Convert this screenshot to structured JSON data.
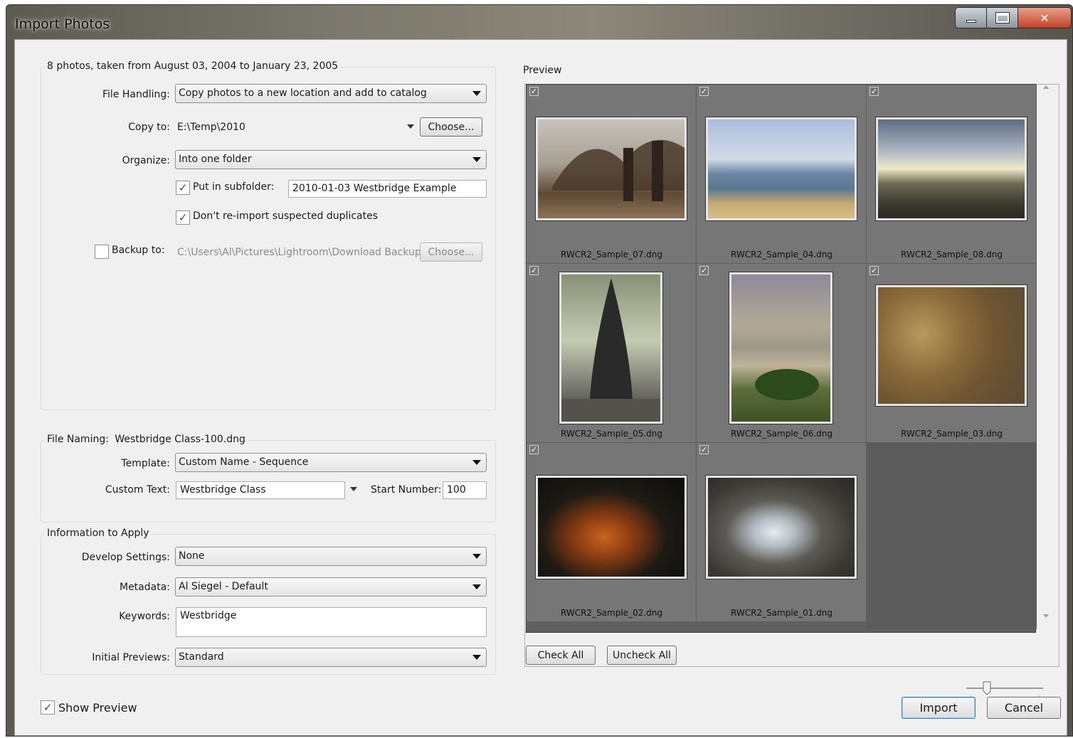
{
  "window": {
    "title": "Import Photos"
  },
  "source_group": {
    "legend": "8 photos, taken from August 03, 2004 to January 23, 2005"
  },
  "file_handling": {
    "label": "File Handling:",
    "value": "Copy photos to a new location and add to catalog"
  },
  "copy_to": {
    "label": "Copy to:",
    "value": "E:\\Temp\\2010",
    "button": "Choose..."
  },
  "organize": {
    "label": "Organize:",
    "value": "Into one folder"
  },
  "subfolder": {
    "checked": true,
    "label": "Put in subfolder:",
    "value": "2010-01-03 Westbridge Example"
  },
  "duplicates": {
    "checked": true,
    "label": "Don't re-import suspected duplicates"
  },
  "backup": {
    "checked": false,
    "label": "Backup to:",
    "value": "C:\\Users\\Al\\Pictures\\Lightroom\\Download Backups",
    "button": "Choose..."
  },
  "naming": {
    "legend_label": "File Naming:",
    "legend_value": "Westbridge Class-100.dng",
    "template_label": "Template:",
    "template_value": "Custom Name - Sequence",
    "custom_text_label": "Custom Text:",
    "custom_text_value": "Westbridge Class",
    "start_number_label": "Start Number:",
    "start_number_value": "100"
  },
  "info": {
    "legend": "Information to Apply",
    "develop_label": "Develop Settings:",
    "develop_value": "None",
    "metadata_label": "Metadata:",
    "metadata_value": "Al Siegel - Default",
    "keywords_label": "Keywords:",
    "keywords_value": "Westbridge",
    "previews_label": "Initial Previews:",
    "previews_value": "Standard"
  },
  "preview": {
    "legend": "Preview",
    "thumbnails": [
      {
        "filename": "RWCR2_Sample_07.dng",
        "checked": true,
        "subject": "bridge"
      },
      {
        "filename": "RWCR2_Sample_04.dng",
        "checked": true,
        "subject": "beach"
      },
      {
        "filename": "RWCR2_Sample_08.dng",
        "checked": true,
        "subject": "harbor"
      },
      {
        "filename": "RWCR2_Sample_05.dng",
        "checked": true,
        "subject": "ship"
      },
      {
        "filename": "RWCR2_Sample_06.dng",
        "checked": true,
        "subject": "coast-tree"
      },
      {
        "filename": "RWCR2_Sample_03.dng",
        "checked": true,
        "subject": "sand"
      },
      {
        "filename": "RWCR2_Sample_02.dng",
        "checked": true,
        "subject": "koi-fish"
      },
      {
        "filename": "RWCR2_Sample_01.dng",
        "checked": true,
        "subject": "stream"
      }
    ],
    "check_all": "Check All",
    "uncheck_all": "Uncheck All"
  },
  "show_preview": {
    "checked": true,
    "label": "Show Preview"
  },
  "buttons": {
    "import": "Import",
    "cancel": "Cancel"
  },
  "icons": {
    "minimize": "minimize-icon",
    "maximize": "maximize-icon",
    "close": "close-icon",
    "dropdown": "chevron-down-icon",
    "check": "checkmark-icon",
    "thumbnail_size": "slider-icon"
  },
  "colors": {
    "grid_background": "#606060",
    "cell_background": "#767676",
    "default_button_border": "#3c7fb1"
  }
}
